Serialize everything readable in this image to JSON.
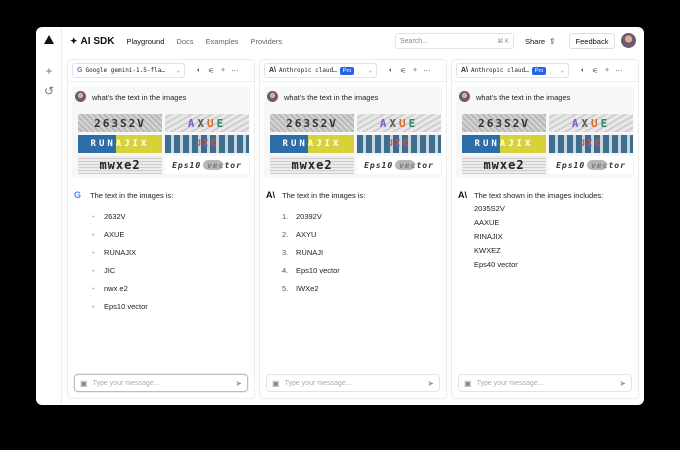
{
  "app": {
    "brand": "AI SDK",
    "nav": [
      "Playground",
      "Docs",
      "Examples",
      "Providers"
    ],
    "search_placeholder": "Search...",
    "search_shortcut": "⌘ K",
    "share_label": "Share",
    "feedback_label": "Feedback"
  },
  "colors": {
    "accent": "#2563eb",
    "google_blue": "#4285f4"
  },
  "icons": {
    "brand": "sparkle-icon",
    "rail": [
      "plus-icon",
      "history-icon"
    ],
    "share": "share-icon"
  },
  "user_prompt": "what's the text in the images",
  "input_placeholder": "Type your message...",
  "panels": [
    {
      "model": "Google gemini-1.5-fla…",
      "model_icon": "G",
      "pro": "",
      "response_intro": "The text in the images is:",
      "list_style": "bullet",
      "items": [
        "2632V",
        "AXUE",
        "RUNAJIX",
        "JIC",
        "nwx e2",
        "Eps10 vector"
      ]
    },
    {
      "model": "Anthropic claud…",
      "model_icon": "A\\",
      "pro": "Pro",
      "response_intro": "The text in the images is:",
      "list_style": "numbered",
      "items": [
        "20392V",
        "AXYU",
        "RUNAJI",
        "Eps10 vector",
        "IWXe2"
      ],
      "numbers": [
        "1.",
        "2.",
        "3.",
        "4.",
        "5."
      ]
    },
    {
      "model": "Anthropic claud…",
      "model_icon": "A\\",
      "pro": "Pro",
      "response_intro": "The text shown in the images includes:",
      "list_style": "plain",
      "items": [
        "2035S2V",
        "AAXUE",
        "RINAJIX",
        "KWXEZ",
        "Eps40 vector"
      ]
    }
  ],
  "captchas": {
    "c1": "263S2V",
    "c2": [
      "A",
      "X",
      "U",
      "E"
    ],
    "c3": "RUNAJIX",
    "c4": "JIC",
    "c5": "mwxe2",
    "c6": "Eps10 vector"
  }
}
